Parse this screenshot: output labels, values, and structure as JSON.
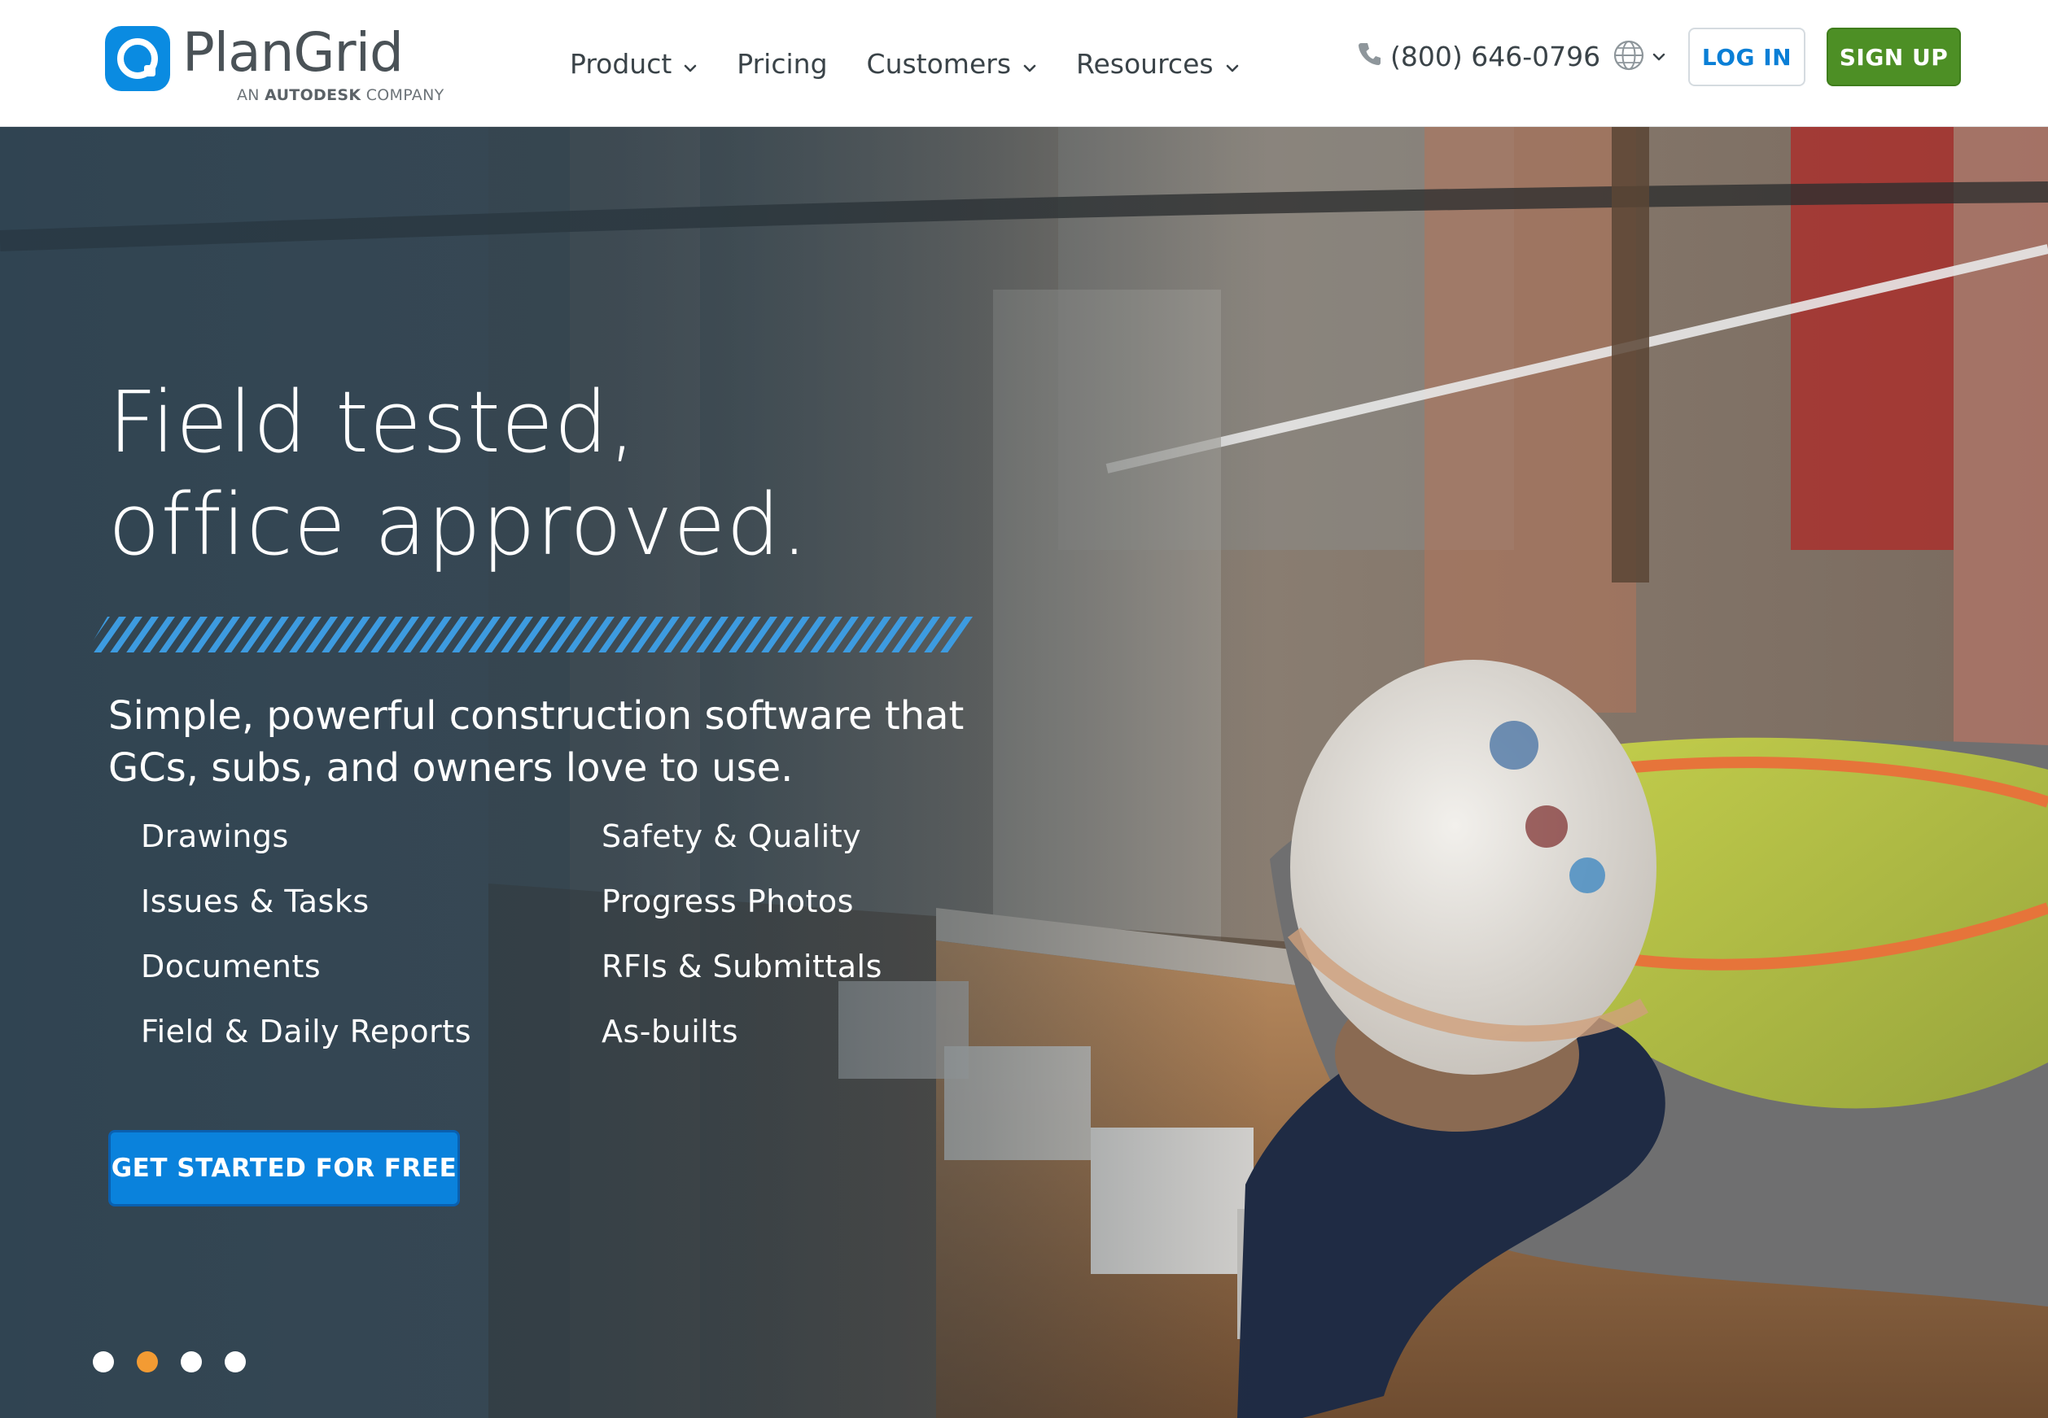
{
  "header": {
    "logo": {
      "name": "PlanGrid",
      "tagline_prefix": "AN",
      "tagline_brand": "AUTODESK",
      "tagline_suffix": "COMPANY"
    },
    "nav": [
      {
        "label": "Product",
        "has_dropdown": true
      },
      {
        "label": "Pricing",
        "has_dropdown": false
      },
      {
        "label": "Customers",
        "has_dropdown": true
      },
      {
        "label": "Resources",
        "has_dropdown": true
      }
    ],
    "phone": "(800) 646-0796",
    "language_icon": "globe-icon",
    "login_label": "LOG IN",
    "signup_label": "SIGN UP"
  },
  "hero": {
    "headline_line1": "Field tested,",
    "headline_line2": "office approved.",
    "subhead": "Simple, powerful construction software that GCs, subs, and owners love to use.",
    "features_left": [
      "Drawings",
      "Issues & Tasks",
      "Documents",
      "Field & Daily Reports"
    ],
    "features_right": [
      "Safety & Quality",
      "Progress Photos",
      "RFIs & Submittals",
      "As-builts"
    ],
    "cta_label": "GET STARTED FOR FREE",
    "carousel": {
      "count": 4,
      "active_index": 1
    }
  },
  "colors": {
    "brand_blue": "#0a8be1",
    "cta_blue": "#0a82dc",
    "signup_green": "#4d8f25",
    "stripe_blue": "#3d9be0",
    "active_dot": "#f39b33",
    "nav_text": "#3a4348"
  }
}
